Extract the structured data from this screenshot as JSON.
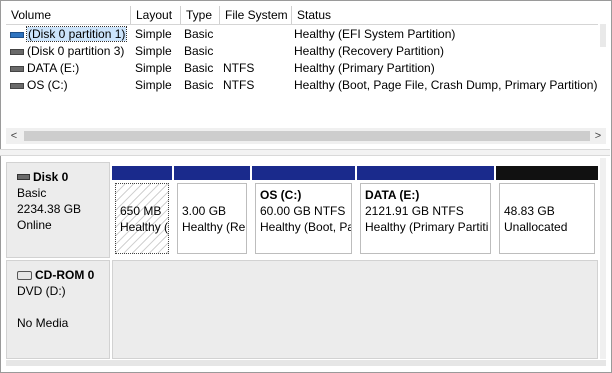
{
  "columns": [
    "Volume",
    "Layout",
    "Type",
    "File System",
    "Status"
  ],
  "volumes": [
    {
      "name": "(Disk 0 partition 1)",
      "layout": "Simple",
      "type": "Basic",
      "fs": "",
      "status": "Healthy (EFI System Partition)",
      "icon": "volume-icon"
    },
    {
      "name": "(Disk 0 partition 3)",
      "layout": "Simple",
      "type": "Basic",
      "fs": "",
      "status": "Healthy (Recovery Partition)",
      "icon": "volume-icon"
    },
    {
      "name": "DATA (E:)",
      "layout": "Simple",
      "type": "Basic",
      "fs": "NTFS",
      "status": "Healthy (Primary Partition)",
      "icon": "volume-icon"
    },
    {
      "name": "OS (C:)",
      "layout": "Simple",
      "type": "Basic",
      "fs": "NTFS",
      "status": "Healthy (Boot, Page File, Crash Dump, Primary Partition)",
      "icon": "volume-icon"
    }
  ],
  "scrollbar": {
    "left_arrow": "<",
    "right_arrow": ">"
  },
  "disk0": {
    "title": "Disk 0",
    "type": "Basic",
    "size": "2234.38 GB",
    "state": "Online",
    "partitions": [
      {
        "name": "",
        "size": "650 MB",
        "status": "Healthy (",
        "bar_color": "#1a2a8c",
        "selected": true
      },
      {
        "name": "",
        "size": "3.00 GB",
        "status": "Healthy (Re",
        "bar_color": "#1a2a8c",
        "selected": false
      },
      {
        "name": "OS  (C:)",
        "size": "60.00 GB NTFS",
        "status": "Healthy (Boot, Pa",
        "bar_color": "#1a2a8c",
        "selected": false
      },
      {
        "name": "DATA  (E:)",
        "size": "2121.91 GB NTFS",
        "status": "Healthy (Primary Partiti",
        "bar_color": "#1a2a8c",
        "selected": false
      },
      {
        "name": "",
        "size": "48.83 GB",
        "status": "Unallocated",
        "bar_color": "#111111",
        "selected": false
      }
    ]
  },
  "cdrom0": {
    "title": "CD-ROM 0",
    "type": "DVD (D:)",
    "media": "No Media"
  }
}
